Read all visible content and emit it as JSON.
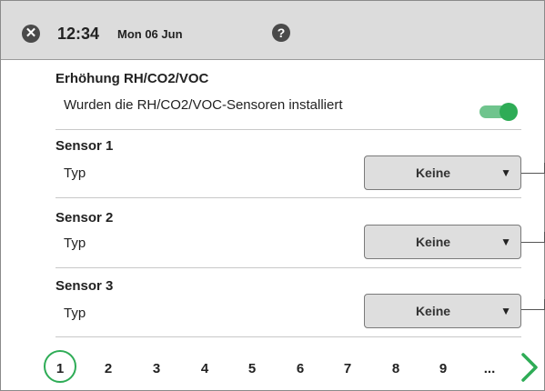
{
  "header": {
    "time": "12:34",
    "date": "Mon 06 Jun",
    "close_icon": "✕",
    "help_icon": "?"
  },
  "enhancement": {
    "title": "Erhöhung RH/CO2/VOC",
    "question": "Wurden die RH/CO2/VOC-Sensoren installiert",
    "toggle_on": true
  },
  "sensors": [
    {
      "title": "Sensor 1",
      "type_label": "Typ",
      "value": "Keine"
    },
    {
      "title": "Sensor 2",
      "type_label": "Typ",
      "value": "Keine"
    },
    {
      "title": "Sensor 3",
      "type_label": "Typ",
      "value": "Keine"
    }
  ],
  "pagination": {
    "pages": [
      "1",
      "2",
      "3",
      "4",
      "5",
      "6",
      "7",
      "8",
      "9",
      "..."
    ],
    "current": "1"
  },
  "colors": {
    "accent": "#2eac56",
    "topbar": "#dcdcdc",
    "select_bg": "#dedede"
  }
}
